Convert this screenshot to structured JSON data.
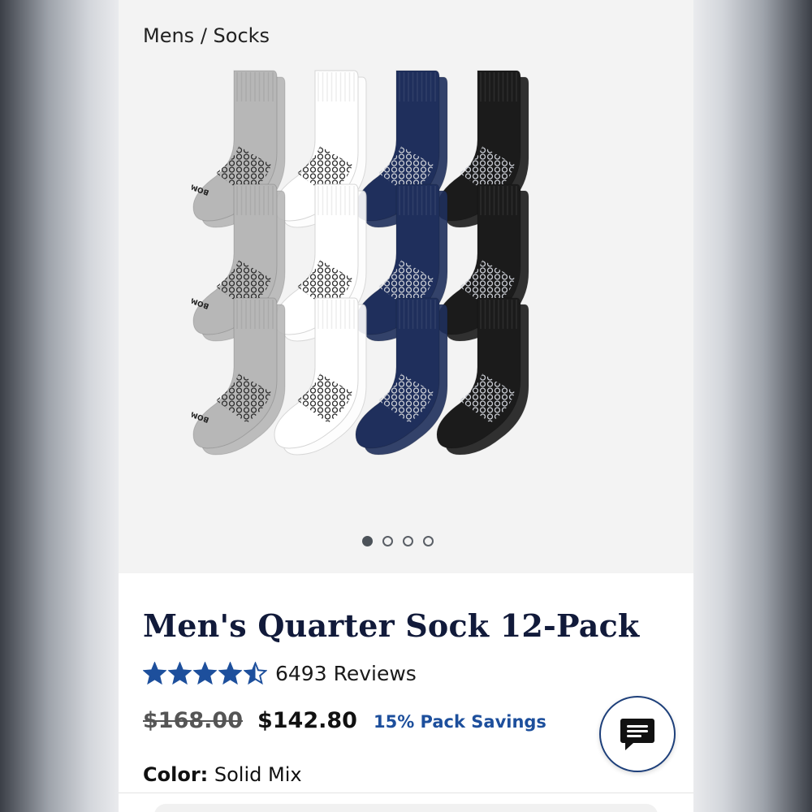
{
  "breadcrumb": "Mens / Socks",
  "gallery": {
    "image_alt": "Men's Quarter Sock 12-Pack",
    "brand_print": "BOMBAS",
    "sock_colors": [
      "#b7b7b7",
      "#ffffff",
      "#1f2f5c",
      "#1b1b1b"
    ],
    "dots": {
      "count": 4,
      "active_index": 0
    }
  },
  "product": {
    "title": "Men's Quarter Sock 12-Pack",
    "rating": 4.5,
    "rating_max": 5,
    "reviews": "6493 Reviews",
    "price": {
      "original": "$168.00",
      "current": "$142.80",
      "savings": "15% Pack Savings"
    },
    "color": {
      "label": "Color:",
      "value": "Solid Mix"
    }
  },
  "icons": {
    "chat": "chat-bubble-icon",
    "star": "star-icon"
  },
  "colors": {
    "star": "#1d4f9c",
    "accent": "#1d4f9c",
    "title": "#111a3a",
    "chat_border": "#1d3f7a"
  }
}
